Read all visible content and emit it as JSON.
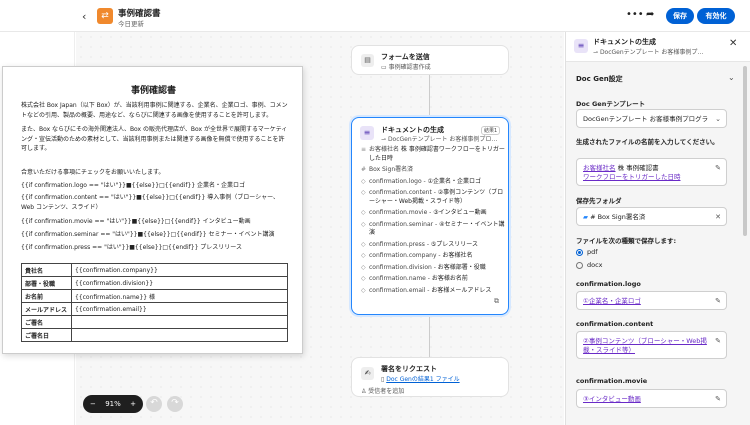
{
  "app": {
    "title": "事例確認書",
    "subtitle": "今日更新",
    "save_label": "保存",
    "enable_label": "有効化",
    "more_icon": "more-icon",
    "share_icon": "share-icon"
  },
  "flow": {
    "form_node": {
      "title": "フォームを送信",
      "subtitle": "事例確認書作成"
    },
    "doc_node": {
      "title": "ドキュメントの生成",
      "badge": "結果1",
      "subtitle": "DocGenテンプレート お客様事例プロ…",
      "rows": [
        {
          "icon": "≡",
          "text": "お客様社名",
          "value": " 株 事例確認書ワークフローをトリガーした日時"
        },
        {
          "icon": "#",
          "text": "Box Sign署名済",
          "value": ""
        },
        {
          "icon": "◇",
          "text": "confirmation.logo - ",
          "value": "①企業名・企業ロゴ"
        },
        {
          "icon": "◇",
          "text": "confirmation.content - ",
          "value": "②事例コンテンツ（ブローシャー・Web掲載・スライド等）"
        },
        {
          "icon": "◇",
          "text": "confirmation.movie - ",
          "value": "③インタビュー動画"
        },
        {
          "icon": "◇",
          "text": "confirmation.seminar - ",
          "value": "④セミナー・イベント講演"
        },
        {
          "icon": "◇",
          "text": "confirmation.press - ",
          "value": "⑤プレスリリース"
        },
        {
          "icon": "◇",
          "text": "confirmation.company - ",
          "value": "お客様社名"
        },
        {
          "icon": "◇",
          "text": "confirmation.division - ",
          "value": "お客様部署・役職"
        },
        {
          "icon": "◇",
          "text": "confirmation.name - ",
          "value": "お客様お名前"
        },
        {
          "icon": "◇",
          "text": "confirmation.email - ",
          "value": "お客様メールアドレス"
        }
      ]
    },
    "sign_node": {
      "title": "署名をリクエスト",
      "subtitle_link": "Doc Genの結果1 ファイル",
      "signers": "受信者を追加"
    }
  },
  "document": {
    "heading": "事例確認書",
    "para1": "株式会社 Box Japan（以下 Box）が、当該利用事例に関連する、企業名、企業ロゴ、事例、コメントなどの引用、製品の概要、用途など、ならびに関連する画像を使用することを許可します。",
    "para2": "また、Box ならびにその海外関連法人、Box の販売代理店が、Box が全世界で展開するマーケティング・宣伝活動のための素材として、当該利用事例または関連する画像を無償で使用することを許可します。",
    "instruction": "合意いただける事項にチェックをお願いいたします。",
    "lines": [
      "{{if confirmation.logo == \"はい\"}}■{{else}}□{{endif}} 企業名・企業ロゴ",
      "{{if confirmation.content == \"はい\"}}■{{else}}□{{endif}} 導入事例（ブローシャー、Web コンテンツ、スライド）",
      "{{if confirmation.movie == \"はい\"}}■{{else}}□{{endif}} インタビュー動画",
      "{{if confirmation.seminar == \"はい\"}}■{{else}}□{{endif}} セミナー・イベント講演",
      "{{if confirmation.press == \"はい\"}}■{{else}}□{{endif}} プレスリリース"
    ],
    "table": [
      {
        "k": "貴社名",
        "v": "{{confirmation.company}}"
      },
      {
        "k": "部署・役職",
        "v": "{{confirmation.division}}"
      },
      {
        "k": "お名前",
        "v": "{{confirmation.name}} 様"
      },
      {
        "k": "メールアドレス",
        "v": "{{confirmation.email}}"
      },
      {
        "k": "ご署名",
        "v": ""
      },
      {
        "k": "ご署名日",
        "v": ""
      }
    ]
  },
  "zoom": {
    "minus": "−",
    "value": "91%",
    "plus": "+"
  },
  "panel": {
    "title": "ドキュメントの生成",
    "subtitle": "DocGenテンプレート お客様事例プ…",
    "section": "Doc Gen設定",
    "template_label": "Doc Genテンプレート",
    "template_value": "DocGenテンプレート お客様事例プログラ…",
    "filename_label": "生成されたファイルの名前を入力してください。",
    "filename_link1": "お客様社名",
    "filename_text": " 株 事例確認書",
    "filename_link2": "ワークフローをトリガーした日時",
    "folder_label": "保存先フォルダ",
    "folder_value": "# Box Sign署名済",
    "filetype_label": "ファイルを次の種類で保存します:",
    "filetype_options": [
      "pdf",
      "docx"
    ],
    "logo_label": "confirmation.logo",
    "logo_value": "①企業名・企業ロゴ",
    "content_label": "confirmation.content",
    "content_value": "②事例コンテンツ（ブローシャー・Web掲載・スライド等）",
    "movie_label": "confirmation.movie",
    "movie_value": "③インタビュー動画"
  }
}
